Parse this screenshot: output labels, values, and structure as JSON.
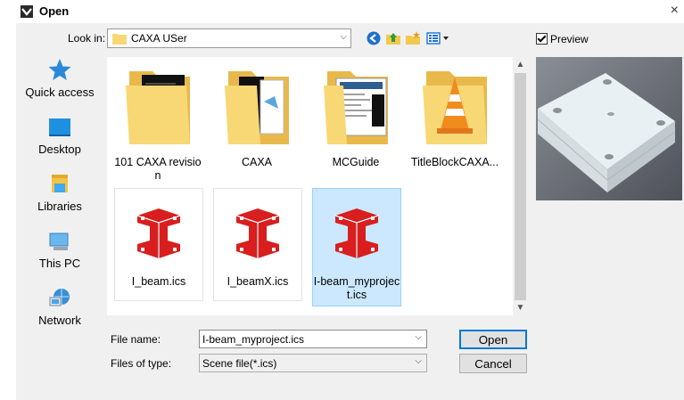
{
  "window": {
    "title": "Open",
    "close_glyph": "×"
  },
  "toolbar": {
    "look_in_label": "Look in:",
    "look_in_value": "CAXA USer",
    "buttons": [
      "back-icon",
      "up-folder-icon",
      "new-folder-icon",
      "view-menu-icon"
    ]
  },
  "preview": {
    "label": "Preview",
    "checked": true
  },
  "places": [
    {
      "label": "Quick access",
      "icon": "star-icon"
    },
    {
      "label": "Desktop",
      "icon": "desktop-icon"
    },
    {
      "label": "Libraries",
      "icon": "libraries-icon"
    },
    {
      "label": "This PC",
      "icon": "computer-icon"
    },
    {
      "label": "Network",
      "icon": "network-icon"
    }
  ],
  "files": [
    {
      "name": "101 CAXA revision",
      "type": "folder"
    },
    {
      "name": "CAXA",
      "type": "folder"
    },
    {
      "name": "MCGuide",
      "type": "folder"
    },
    {
      "name": "TitleBlockCAXA...",
      "type": "folder"
    },
    {
      "name": "I_beam.ics",
      "type": "ics",
      "selected": false
    },
    {
      "name": "I_beamX.ics",
      "type": "ics",
      "selected": false
    },
    {
      "name": "I-beam_myproject.ics",
      "type": "ics",
      "selected": true
    }
  ],
  "form": {
    "file_name_label": "File name:",
    "file_name_value": "I-beam_myproject.ics",
    "file_type_label": "Files of type:",
    "file_type_value": "Scene file(*.ics)",
    "open_label": "Open",
    "cancel_label": "Cancel"
  },
  "colors": {
    "selection": "#cce8ff",
    "accent": "#0078d7",
    "folder": "#f8d775",
    "ibeam": "#d81e1e"
  }
}
